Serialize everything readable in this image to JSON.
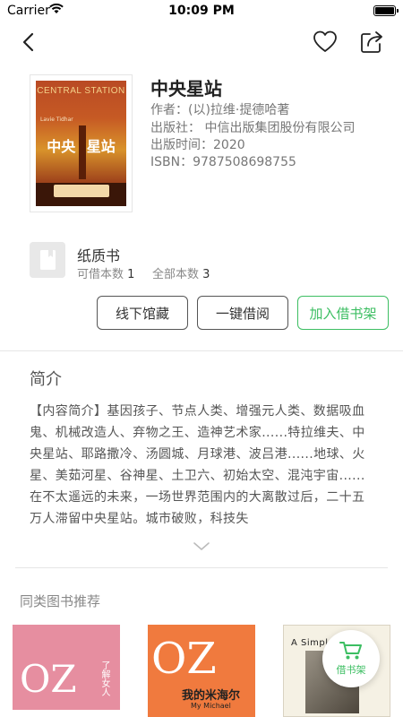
{
  "status_bar": {
    "carrier": "Carrier",
    "time": "10:09 PM"
  },
  "book": {
    "title": "中央星站",
    "author": "作者：(以)拉维·提德哈著",
    "publisher": "出版社： 中信出版集团股份有限公司",
    "pub_date": "出版时间：2020",
    "isbn": "ISBN：9787508698755",
    "cover_en": "CENTRAL STATION",
    "cover_author": "Lavie Tidhar",
    "cover_zh_1": "中央",
    "cover_zh_2": "星站"
  },
  "paper": {
    "label": "纸质书",
    "available_label": "可借本数",
    "available_count": "1",
    "total_label": "全部本数",
    "total_count": "3"
  },
  "actions": {
    "offline": "线下馆藏",
    "borrow": "一键借阅",
    "add_shelf": "加入借书架"
  },
  "intro": {
    "title": "简介",
    "text": "【内容简介】基因孩子、节点人类、增强元人类、数据吸血鬼、机械改造人、弃物之王、造神艺术家......特拉维夫、中央星站、耶路撒冷、汤圆城、月球港、波吕港......地球、火星、美茹河星、谷神星、土卫六、初始太空、混沌宇宙......在不太遥远的未来，一场世界范围内的大离散过后，二十五万人滞留中央星站。城市破败，科技失"
  },
  "recommend": {
    "title": "同类图书推荐",
    "book1_oz": "OZ",
    "book1_text": "了解女人",
    "book2_oz": "OZ",
    "book2_title": "我的米海尔",
    "book2_sub": "My Michael",
    "book3_title": "A Simple Story"
  },
  "cart": {
    "label": "借书架"
  },
  "colors": {
    "accent": "#3cbe62",
    "text": "#333333",
    "muted": "#888888"
  }
}
